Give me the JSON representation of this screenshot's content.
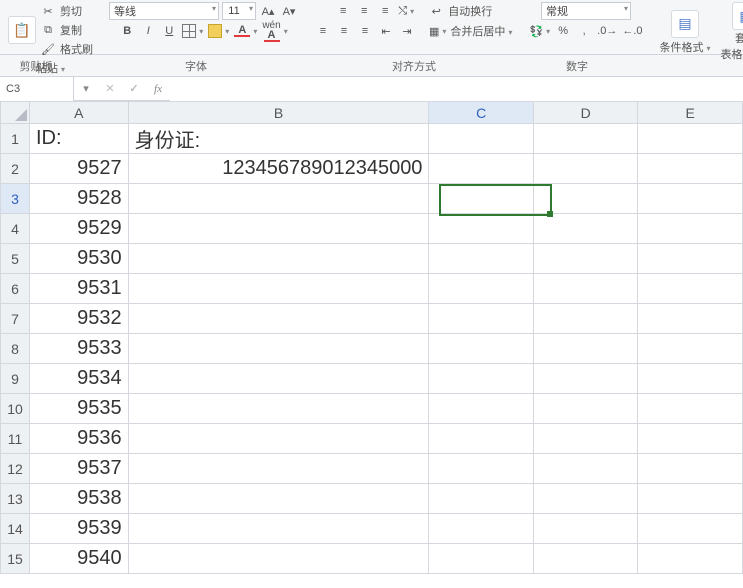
{
  "ribbon": {
    "clipboard": {
      "cut": "剪切",
      "copy": "复制",
      "format_painter": "格式刷",
      "paste": "粘贴",
      "group_label": "剪贴板"
    },
    "font": {
      "font_name": "等线",
      "font_size": "11",
      "bold": "B",
      "italic": "I",
      "underline": "U",
      "font_color_letter": "A",
      "group_label": "字体"
    },
    "alignment": {
      "wrap_text": "自动换行",
      "merge_center": "合并后居中",
      "group_label": "对齐方式"
    },
    "number": {
      "format": "常规",
      "currency": "¥",
      "percent": "%",
      "comma": ",",
      "inc_dec": "◦",
      "group_label": "数字"
    },
    "styles": {
      "cond_fmt": "条件格式",
      "cell_styles_l1": "套用",
      "cell_styles_l2": "表格格式"
    }
  },
  "namebox": {
    "value": "C3"
  },
  "formula": {
    "value": ""
  },
  "columns": [
    "A",
    "B",
    "C",
    "D",
    "E"
  ],
  "active_col": "C",
  "active_row": 3,
  "headers": {
    "A": "ID:",
    "B": "身份证:"
  },
  "rows": [
    {
      "n": 1,
      "A": "ID:",
      "A_align": "left",
      "B": "身份证:",
      "B_align": "left"
    },
    {
      "n": 2,
      "A": "9527",
      "A_align": "right",
      "B": "123456789012345000",
      "B_align": "right"
    },
    {
      "n": 3,
      "A": "9528",
      "A_align": "right",
      "B": ""
    },
    {
      "n": 4,
      "A": "9529",
      "A_align": "right",
      "B": ""
    },
    {
      "n": 5,
      "A": "9530",
      "A_align": "right",
      "B": ""
    },
    {
      "n": 6,
      "A": "9531",
      "A_align": "right",
      "B": ""
    },
    {
      "n": 7,
      "A": "9532",
      "A_align": "right",
      "B": ""
    },
    {
      "n": 8,
      "A": "9533",
      "A_align": "right",
      "B": ""
    },
    {
      "n": 9,
      "A": "9534",
      "A_align": "right",
      "B": ""
    },
    {
      "n": 10,
      "A": "9535",
      "A_align": "right",
      "B": ""
    },
    {
      "n": 11,
      "A": "9536",
      "A_align": "right",
      "B": ""
    },
    {
      "n": 12,
      "A": "9537",
      "A_align": "right",
      "B": ""
    },
    {
      "n": 13,
      "A": "9538",
      "A_align": "right",
      "B": ""
    },
    {
      "n": 14,
      "A": "9539",
      "A_align": "right",
      "B": ""
    },
    {
      "n": 15,
      "A": "9540",
      "A_align": "right",
      "B": ""
    }
  ],
  "selection": {
    "col": "C",
    "row": 3
  }
}
